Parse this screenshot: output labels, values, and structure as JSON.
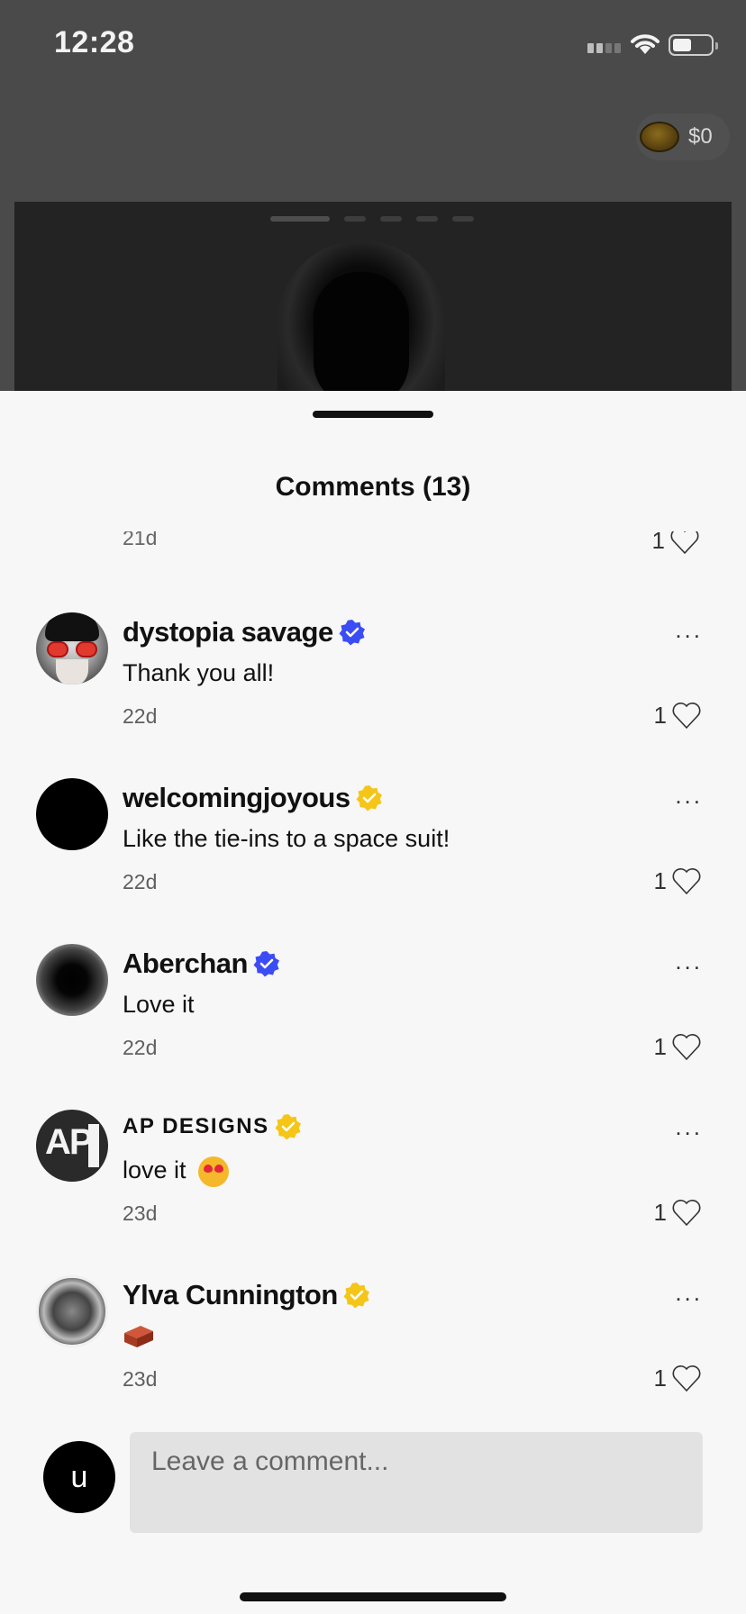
{
  "status_bar": {
    "time": "12:28"
  },
  "wallet": {
    "amount": "$0"
  },
  "comments_sheet": {
    "title": "Comments (13)",
    "partial_item": {
      "ago": "21d",
      "likes": "1"
    },
    "items": [
      {
        "username": "dystopia savage",
        "badge_color": "#3b4cf5",
        "text": "Thank you all!",
        "ago": "22d",
        "likes": "1"
      },
      {
        "username": "welcomingjoyous",
        "badge_color": "#f5c518",
        "text": "Like the tie-ins to a space suit!",
        "ago": "22d",
        "likes": "1"
      },
      {
        "username": "Aberchan",
        "badge_color": "#3b4cf5",
        "text": "Love it",
        "ago": "22d",
        "likes": "1"
      },
      {
        "username": "AP DESIGNS",
        "badge_color": "#f5c518",
        "text": "love it",
        "ago": "23d",
        "likes": "1",
        "avatar_text": "AP"
      },
      {
        "username": "Ylva Cunnington",
        "badge_color": "#f5c518",
        "text": "",
        "ago": "23d",
        "likes": "1"
      }
    ],
    "more_label": "...",
    "composer": {
      "avatar_initial": "u",
      "placeholder": "Leave a comment..."
    }
  }
}
